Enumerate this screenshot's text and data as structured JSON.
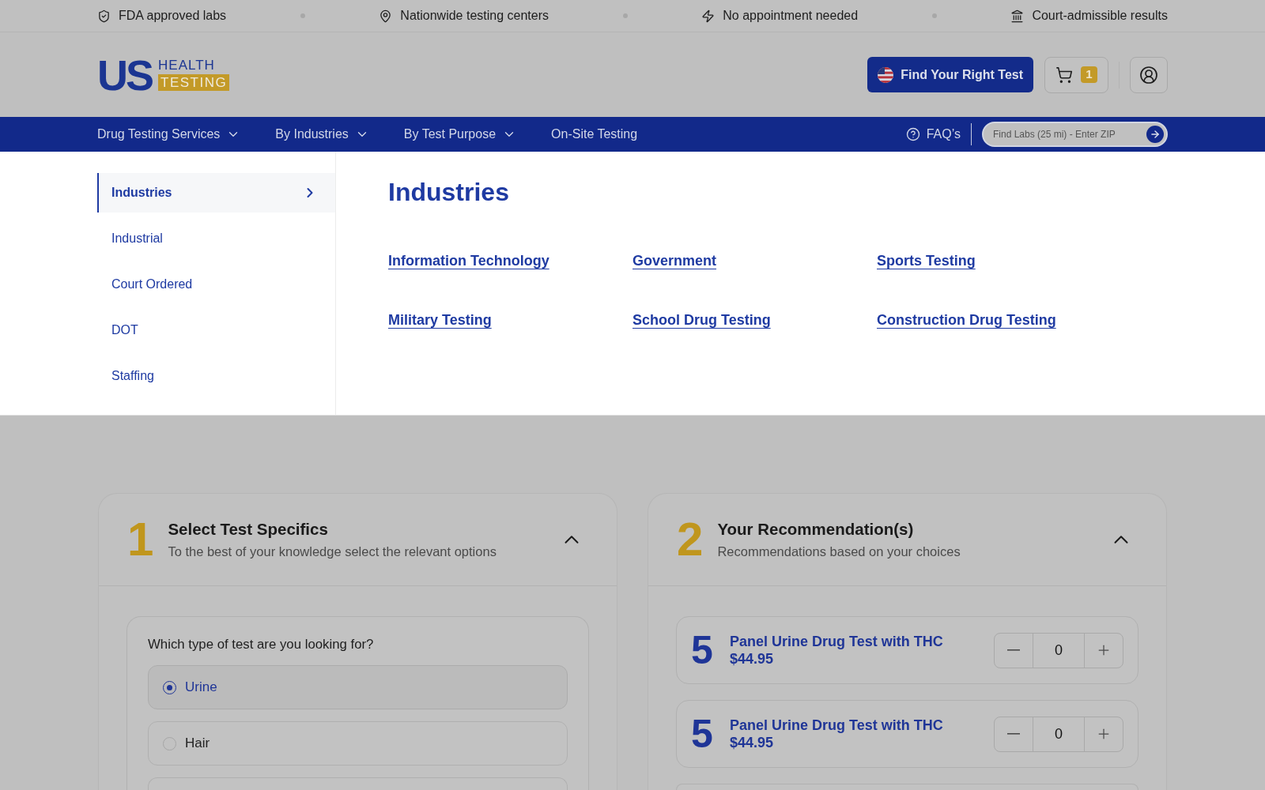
{
  "top_bar": {
    "items": [
      "FDA approved labs",
      "Nationwide testing centers",
      "No appointment needed",
      "Court-admissible results"
    ]
  },
  "header": {
    "logo": {
      "mark": "US",
      "line_1": "HEALTH",
      "line_2": "TESTING"
    },
    "cta_button": "Find Your Right Test",
    "cart_count": "1"
  },
  "nav": {
    "items": [
      {
        "label": "Drug Testing Services",
        "dropdown": true
      },
      {
        "label": "By Industries",
        "dropdown": true
      },
      {
        "label": "By Test Purpose",
        "dropdown": true
      },
      {
        "label": "On-Site Testing",
        "dropdown": false
      }
    ],
    "faq": "FAQ’s",
    "search": {
      "placeholder": "Find Labs (25 mi) - Enter ZIP"
    }
  },
  "mega_menu": {
    "sidebar": [
      {
        "label": "Industries",
        "selected": true
      },
      {
        "label": "Industrial",
        "selected": false
      },
      {
        "label": "Court Ordered",
        "selected": false
      },
      {
        "label": "DOT",
        "selected": false
      },
      {
        "label": "Staffing",
        "selected": false
      }
    ],
    "heading": "Industries",
    "links": [
      "Information Technology",
      "Government",
      "Sports Testing",
      "Military Testing",
      "School Drug Testing",
      "Construction Drug Testing"
    ]
  },
  "steps": [
    {
      "kind": "question",
      "number": "1",
      "title": "Select Test Specifics",
      "subtitle": "To the best of your knowledge select the relevant options",
      "expanded": true,
      "question": "Which type of test are you looking for?",
      "options": [
        {
          "label": "Urine",
          "selected": true
        },
        {
          "label": "Hair",
          "selected": false
        }
      ],
      "more_below": true
    },
    {
      "kind": "recommendations",
      "number": "2",
      "title": "Your Recommendation(s)",
      "subtitle": "Recommendations based on your choices",
      "expanded": true,
      "items": [
        {
          "number": "5",
          "title": "Panel Urine Drug Test with THC",
          "price": "$44.95",
          "quantity": "0"
        },
        {
          "number": "5",
          "title": "Panel Urine Drug Test with THC",
          "price": "$44.95",
          "quantity": "0"
        }
      ],
      "more_below": true
    }
  ]
}
